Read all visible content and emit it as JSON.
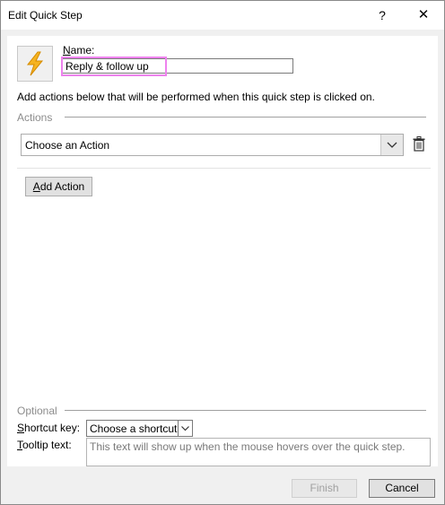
{
  "window": {
    "title": "Edit Quick Step",
    "help_glyph": "?",
    "close_glyph": "✕"
  },
  "quick_step": {
    "icon": "lightning-icon",
    "name_label_prefix": "N",
    "name_label_rest": "ame:",
    "name_value": "Reply & follow up",
    "highlight_color": "#ee82ee"
  },
  "instruction": "Add actions below that will be performed when this quick step is clicked on.",
  "actions": {
    "section_label": "Actions",
    "selected_action": "Choose an Action",
    "add_button_prefix": "A",
    "add_button_rest": "dd Action"
  },
  "optional": {
    "section_label": "Optional",
    "shortcut_label_prefix": "S",
    "shortcut_label_rest": "hortcut key:",
    "shortcut_value": "Choose a shortcut",
    "tooltip_label_prefix": "T",
    "tooltip_label_rest": "ooltip text:",
    "tooltip_placeholder": "This text will show up when the mouse hovers over the quick step."
  },
  "footer": {
    "finish_label": "Finish",
    "cancel_label": "Cancel"
  }
}
